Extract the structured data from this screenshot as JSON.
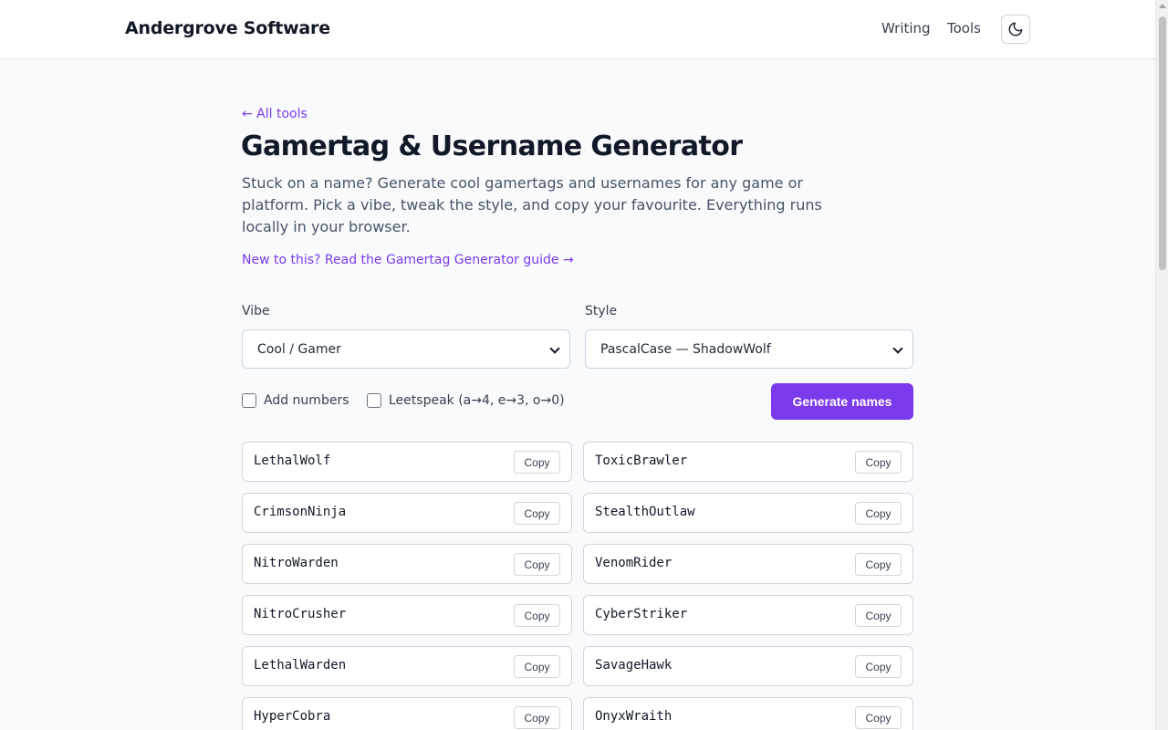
{
  "header": {
    "brand": "Andergrove Software",
    "nav": [
      "Writing",
      "Tools"
    ],
    "theme_icon": "moon-icon"
  },
  "back_link": "← All tools",
  "title": "Gamertag & Username Generator",
  "intro": "Stuck on a name? Generate cool gamertags and usernames for any game or platform. Pick a vibe, tweak the style, and copy your favourite. Everything runs locally in your browser.",
  "guide_link": "New to this? Read the Gamertag Generator guide →",
  "controls": {
    "vibe_label": "Vibe",
    "vibe_value": "Cool / Gamer",
    "style_label": "Style",
    "style_value": "PascalCase — ShadowWolf",
    "add_numbers_label": "Add numbers",
    "add_numbers_checked": false,
    "leetspeak_label": "Leetspeak (a→4, e→3, o→0)",
    "leetspeak_checked": false,
    "generate_label": "Generate names"
  },
  "copy_label": "Copy",
  "names": [
    "LethalWolf",
    "ToxicBrawler",
    "CrimsonNinja",
    "StealthOutlaw",
    "NitroWarden",
    "VenomRider",
    "NitroCrusher",
    "CyberStriker",
    "LethalWarden",
    "SavageHawk",
    "HyperCobra",
    "OnyxWraith"
  ],
  "colors": {
    "accent": "#7c3aed",
    "background": "#f8fafc"
  }
}
